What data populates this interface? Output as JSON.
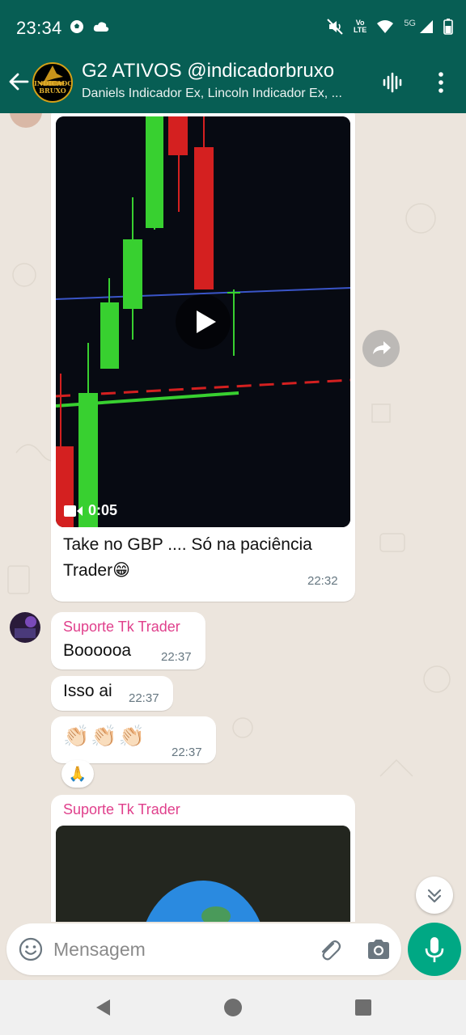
{
  "status_bar": {
    "time": "23:34",
    "network_label_top": "Vo",
    "network_label_bottom": "LTE",
    "network_5g": "5G",
    "icons": [
      "soccer-ball-icon",
      "cloud-icon",
      "mute-icon",
      "wifi-icon",
      "signal-icon",
      "battery-icon"
    ]
  },
  "header": {
    "group_name": "G2 ATIVOS @indicadorbruxo",
    "members": "Daniels Indicador Ex, Lincoln Indicador Ex, ...",
    "avatar_text_line1": "INDICADOR",
    "avatar_text_line2": "BRUXO"
  },
  "messages": {
    "video_message": {
      "duration": "0:05",
      "caption_line1": "Take no GBP .... Só na paciência",
      "caption_line2": "Trader😁",
      "time": "22:32"
    },
    "msg1": {
      "sender": "Suporte Tk Trader",
      "text": "Boooooa",
      "time": "22:37"
    },
    "msg2": {
      "text": "Isso ai",
      "time": "22:37"
    },
    "msg3": {
      "text": "👏🏻👏🏻👏🏻",
      "time": "22:37",
      "reaction": "🙏"
    },
    "msg4": {
      "sender": "Suporte Tk Trader"
    }
  },
  "input": {
    "placeholder": "Mensagem"
  },
  "colors": {
    "header_bg": "#075e54",
    "chat_bg": "#ece5dd",
    "sender_name": "#e0408c",
    "mic_button": "#00a884"
  }
}
